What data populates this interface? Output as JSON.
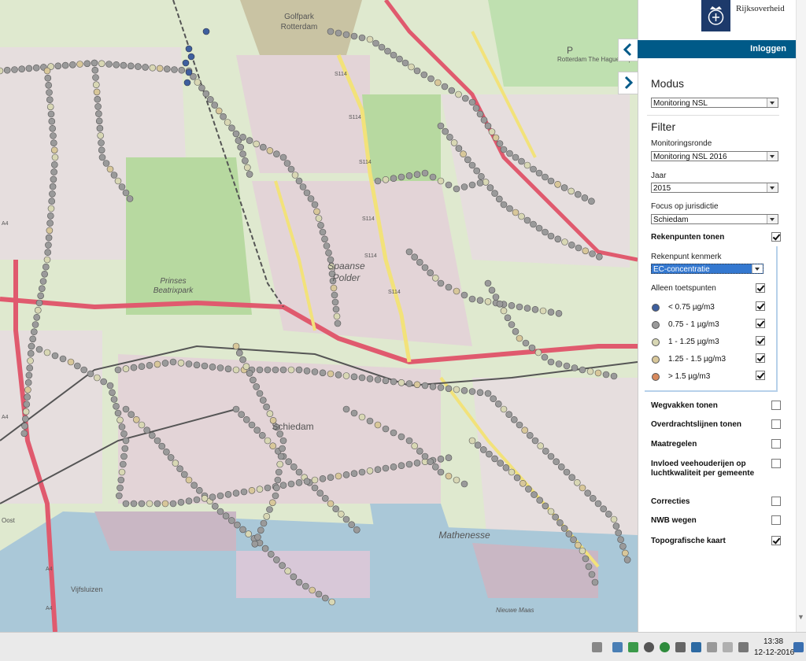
{
  "header": {
    "logo_name": "Rijksoverheid",
    "login_label": "Inloggen",
    "logo_icon": "crown-coat-of-arms-icon",
    "logo_color": "#1d3a6b",
    "login_bar_color": "#005a88"
  },
  "sidebar": {
    "collapse_icon": "chevron-left-icon",
    "expand_icon": "chevron-right-icon",
    "modus": {
      "title": "Modus",
      "value": "Monitoring NSL"
    },
    "filter": {
      "title": "Filter",
      "monitoringsronde_label": "Monitoringsronde",
      "monitoringsronde_value": "Monitoring NSL 2016",
      "jaar_label": "Jaar",
      "jaar_value": "2015",
      "focus_label": "Focus op jurisdictie",
      "focus_value": "Schiedam"
    },
    "rekenpunten": {
      "label": "Rekenpunten tonen",
      "checked": true,
      "kenmerk_label": "Rekenpunt kenmerk",
      "kenmerk_value": "EC-concentratie",
      "alleen_label": "Alleen toetspunten",
      "alleen_checked": true,
      "legend": [
        {
          "label": "< 0.75 µg/m3",
          "color": "#3e5f9e",
          "checked": true
        },
        {
          "label": "0.75 - 1 µg/m3",
          "color": "#9a9a9a",
          "checked": true
        },
        {
          "label": "1 - 1.25 µg/m3",
          "color": "#d8d7b4",
          "checked": true
        },
        {
          "label": "1.25 - 1.5 µg/m3",
          "color": "#d8c79a",
          "checked": true
        },
        {
          "label": "> 1.5 µg/m3",
          "color": "#d88a5e",
          "checked": true
        }
      ]
    },
    "layers": [
      {
        "label": "Wegvakken tonen",
        "checked": false
      },
      {
        "label": "Overdrachtslijnen tonen",
        "checked": false
      },
      {
        "label": "Maatregelen",
        "checked": false
      },
      {
        "label": "Invloed veehouderijen op luchtkwaliteit per gemeente",
        "checked": false
      },
      {
        "label": "Correcties",
        "checked": false
      },
      {
        "label": "NWB wegen",
        "checked": false
      },
      {
        "label": "Topografische kaart",
        "checked": true
      }
    ]
  },
  "map": {
    "labels": {
      "golfpark": "Golfpark",
      "rotterdam": "Rotterdam",
      "spaanse": "Spaanse",
      "polder": "Polder",
      "prinses": "Prinses",
      "beatrixpark": "Beatrixpark",
      "schiedam": "Schiedam",
      "mathenesse": "Mathenesse",
      "airport": "Rotterdam The Hague Airport",
      "s114": "S114",
      "s114b": "S114",
      "s114c": "S114",
      "s114d": "S114",
      "s114e": "S114",
      "s114f": "S114",
      "a4": "A4",
      "a4b": "A4",
      "a4c": "A4",
      "a4d": "A4",
      "oost": "Oost",
      "vijfsluizen": "Vijfsluizen",
      "nieuwe_maas": "Nieuwe Maas",
      "parking": "P"
    },
    "colors": {
      "land": "#dfe9cf",
      "urban": "#e3d4d7",
      "water": "#aac8d8",
      "green": "#b7d9a0",
      "motorway": "#e05a6e",
      "primary": "#f2e27a",
      "rail": "#555555"
    }
  },
  "taskbar": {
    "time": "13:38",
    "date": "12-12-2016",
    "tray_icons": [
      "keyboard-icon",
      "monitor-icon",
      "shield-icon",
      "network-icon",
      "update-icon",
      "display-icon",
      "user-icon",
      "clipboard-icon",
      "folder-icon",
      "volume-icon",
      "desktop-icon"
    ]
  }
}
